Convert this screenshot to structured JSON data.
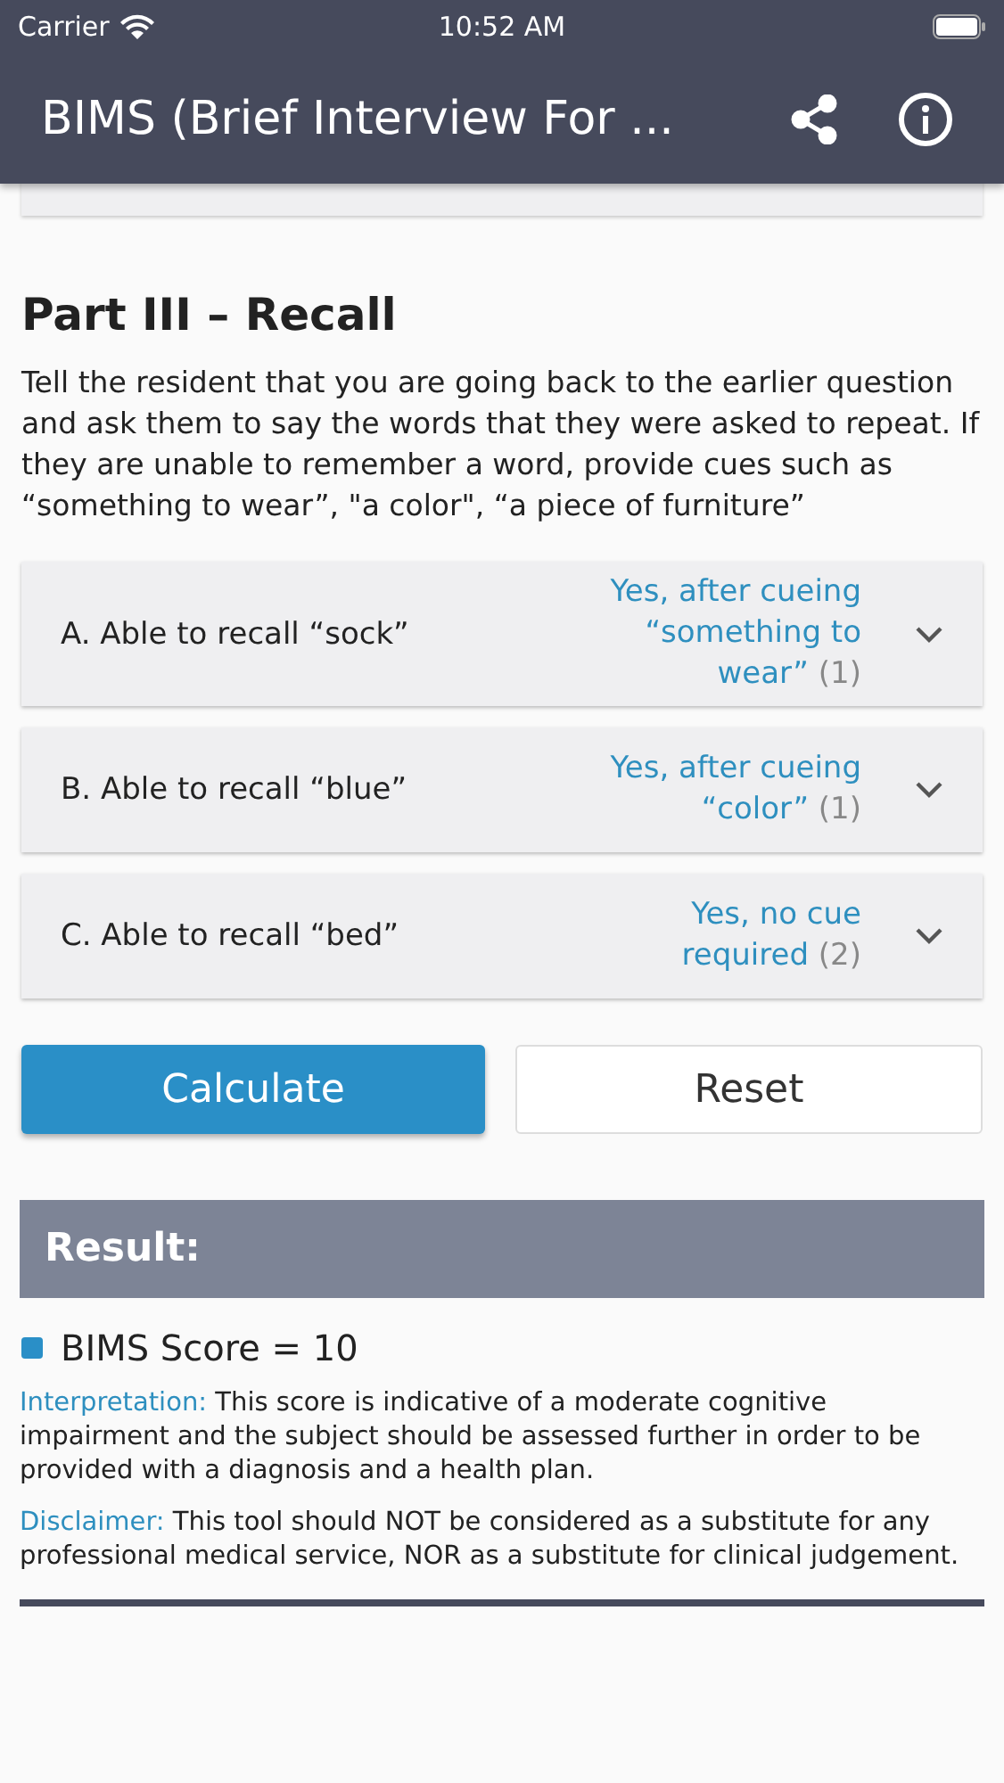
{
  "status_bar": {
    "carrier": "Carrier",
    "time": "10:52 AM"
  },
  "header": {
    "title": "BIMS (Brief Interview For ..."
  },
  "section": {
    "title": "Part III – Recall",
    "instructions": "Tell the resident that you are going back to the earlier question and ask them to say the words that they were asked to repeat. If they are unable to remember a word, provide cues such as “something to wear”, \"a color\", “a piece of furniture”"
  },
  "questions": [
    {
      "label": "A. Able to recall “sock”",
      "answer": "Yes, after cueing “something to wear”",
      "points": "(1)"
    },
    {
      "label": "B. Able to recall “blue”",
      "answer": "Yes, after cueing “color”",
      "points": "(1)"
    },
    {
      "label": "C. Able to recall “bed”",
      "answer": "Yes, no cue required",
      "points": "(2)"
    }
  ],
  "buttons": {
    "calculate": "Calculate",
    "reset": "Reset"
  },
  "result": {
    "title": "Result:",
    "score": "BIMS Score = 10",
    "notes": [
      {
        "label": "Interpretation:",
        "text": "This score is indicative of a moderate cognitive impairment and the subject should be assessed further in order to be provided with a diagnosis and a health plan."
      },
      {
        "label": "Disclaimer:",
        "text": "This tool should NOT be considered as a substitute for any professional medical service, NOR as a substitute for clinical judgement."
      }
    ]
  }
}
